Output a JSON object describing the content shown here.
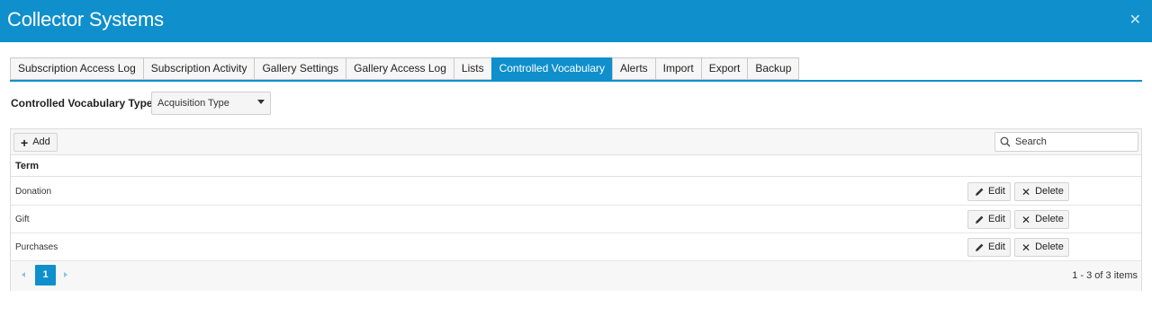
{
  "window": {
    "title": "Collector Systems",
    "close_icon": "close-icon"
  },
  "tabs": [
    {
      "label": "Subscription Access Log",
      "active": false
    },
    {
      "label": "Subscription Activity",
      "active": false
    },
    {
      "label": "Gallery Settings",
      "active": false
    },
    {
      "label": "Gallery Access Log",
      "active": false
    },
    {
      "label": "Lists",
      "active": false
    },
    {
      "label": "Controlled Vocabulary",
      "active": true
    },
    {
      "label": "Alerts",
      "active": false
    },
    {
      "label": "Import",
      "active": false
    },
    {
      "label": "Export",
      "active": false
    },
    {
      "label": "Backup",
      "active": false
    }
  ],
  "vocab_type": {
    "label": "Controlled Vocabulary Type:",
    "selected": "Acquisition Type"
  },
  "toolbar": {
    "add_label": "Add",
    "search_placeholder": "Search"
  },
  "table": {
    "header": "Term",
    "rows": [
      {
        "term": "Donation"
      },
      {
        "term": "Gift"
      },
      {
        "term": "Purchases"
      }
    ],
    "edit_label": "Edit",
    "delete_label": "Delete"
  },
  "pager": {
    "current_page": "1",
    "info": "1 - 3 of 3 items"
  },
  "colors": {
    "accent": "#0f8fcc"
  }
}
